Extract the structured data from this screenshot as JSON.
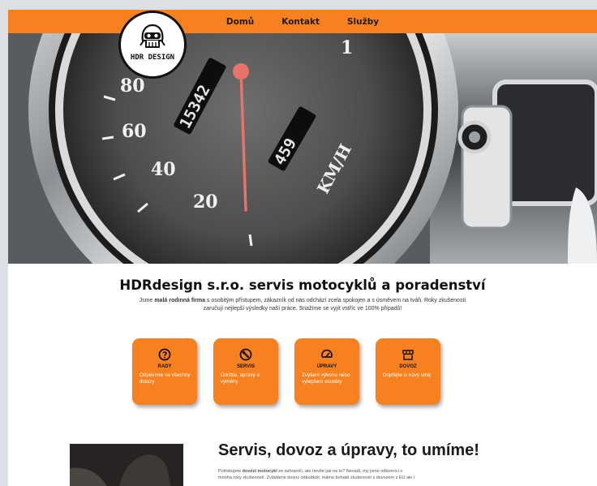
{
  "nav": {
    "items": [
      "Domů",
      "Kontakt",
      "Služby"
    ]
  },
  "logo": {
    "text": "HDR DESIGN",
    "icon": "skull-helmet-icon"
  },
  "hero": {
    "odometer": "15342",
    "trip": "459",
    "unit": "KM/H",
    "speed_labels": [
      "20",
      "40",
      "60",
      "80",
      "1"
    ]
  },
  "brand": {
    "title": "HDRdesign s.r.o. servis motocyklů a poradenství",
    "intro_prefix": "Jsme ",
    "intro_bold": "malá rodinná firma",
    "intro_rest_line1": " s osobitým přístupem, zákazník od nás odchází zcela spokojen a s úsměvem na tváři. Roky zkušeností",
    "intro_line2": "zaručují nejlepší výsledky naší práce. Snažíme se vyjít vstříc ve 100% případů!"
  },
  "cards": [
    {
      "icon": "question-circle-icon",
      "title": "RADY",
      "desc": "Odpovíme na všechny dotazy"
    },
    {
      "icon": "wrench-circle-icon",
      "title": "SERVIS",
      "desc": "Údržba, opravy a výměny"
    },
    {
      "icon": "gauge-icon",
      "title": "ÚPRAVY",
      "desc": "Zvýšení výkonu nebo vylepšení estetiky"
    },
    {
      "icon": "store-icon",
      "title": "DOVOZ",
      "desc": "Dopřejte si nový stroj"
    }
  ],
  "section": {
    "title": "Servis, dovoz a úpravy, to umíme!",
    "text_prefix": "Potřebujete ",
    "text_bold": "dovézt motocykl",
    "text_rest_line1": " ze zahraničí, ale nevíte jak na to? Nevadí, my jsme odborníci s",
    "text_line2": "mnoha roky zkušeností. Zvládáme dovoz odkudkoli, máme bohaté zkušenosti s dovozem z EU ale i"
  },
  "colors": {
    "accent": "#f7811f",
    "background": "#dcdfe3",
    "needle": "#e8736a"
  }
}
